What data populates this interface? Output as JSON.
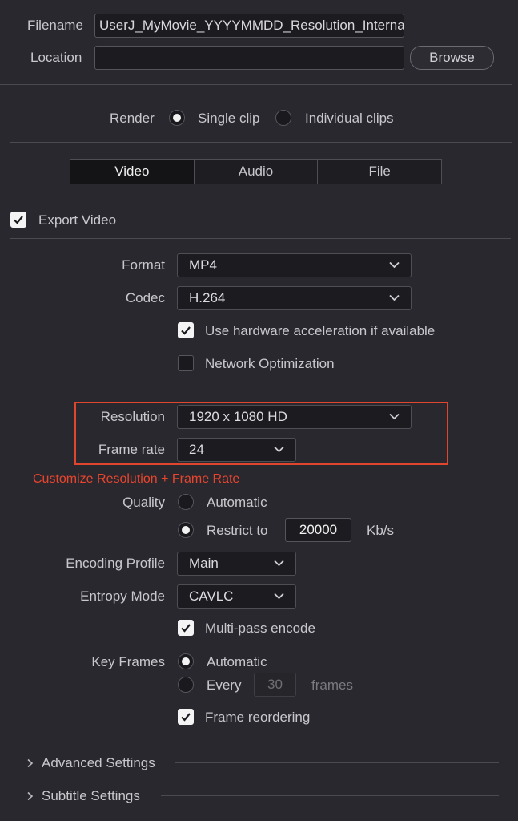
{
  "file": {
    "filename_label": "Filename",
    "filename_value": "UserJ_MyMovie_YYYYMMDD_Resolution_Internal",
    "location_label": "Location",
    "location_value": "",
    "browse_label": "Browse"
  },
  "render": {
    "label": "Render",
    "single_clip": "Single clip",
    "individual_clips": "Individual clips",
    "selected": "single_clip"
  },
  "tabs": [
    {
      "label": "Video",
      "active": true
    },
    {
      "label": "Audio",
      "active": false
    },
    {
      "label": "File",
      "active": false
    }
  ],
  "export_video": {
    "label": "Export Video",
    "checked": true
  },
  "format": {
    "label": "Format",
    "value": "MP4"
  },
  "codec": {
    "label": "Codec",
    "value": "H.264"
  },
  "hw_accel": {
    "label": "Use hardware acceleration if available",
    "checked": true
  },
  "network_opt": {
    "label": "Network Optimization",
    "checked": false
  },
  "resolution": {
    "label": "Resolution",
    "value": "1920 x 1080 HD"
  },
  "frame_rate": {
    "label": "Frame rate",
    "value": "24"
  },
  "annotation": "Customize Resolution + Frame Rate",
  "quality": {
    "label": "Quality",
    "automatic": "Automatic",
    "restrict": "Restrict to",
    "restrict_value": "20000",
    "unit": "Kb/s",
    "selected": "restrict"
  },
  "encoding_profile": {
    "label": "Encoding Profile",
    "value": "Main"
  },
  "entropy_mode": {
    "label": "Entropy Mode",
    "value": "CAVLC"
  },
  "multipass": {
    "label": "Multi-pass encode",
    "checked": true
  },
  "key_frames": {
    "label": "Key Frames",
    "automatic": "Automatic",
    "every": "Every",
    "every_value": "30",
    "unit": "frames",
    "selected": "automatic"
  },
  "frame_reorder": {
    "label": "Frame reordering",
    "checked": true
  },
  "sections": {
    "advanced": "Advanced Settings",
    "subtitle": "Subtitle Settings"
  },
  "colors": {
    "annotation": "#e0452e",
    "background": "#28282e"
  }
}
